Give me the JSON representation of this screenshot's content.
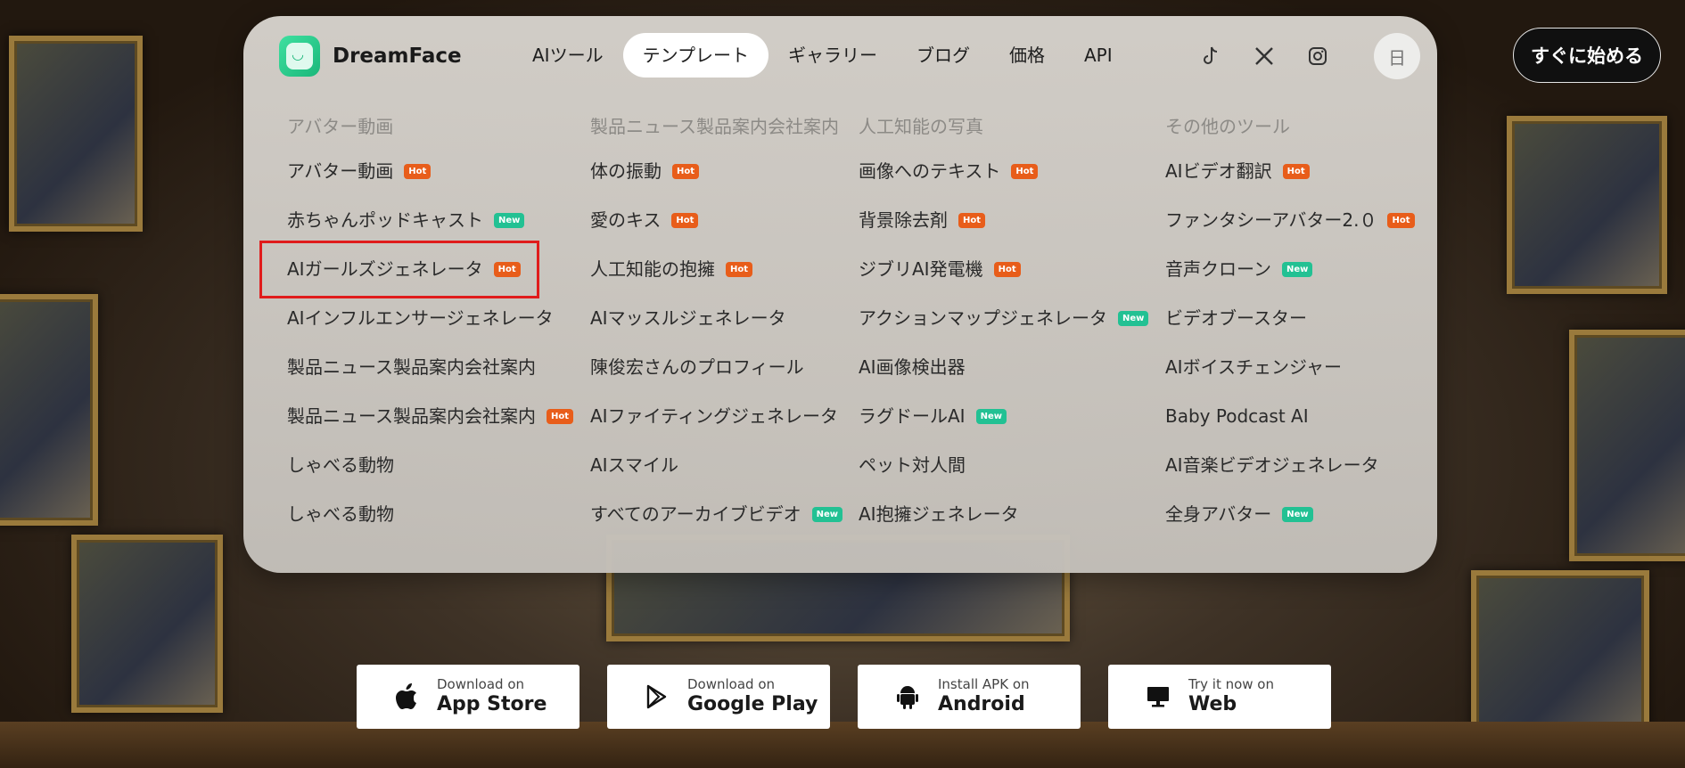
{
  "header": {
    "brand": "DreamFace",
    "nav": [
      {
        "label": "AIツール",
        "active": false
      },
      {
        "label": "テンプレート",
        "active": true
      },
      {
        "label": "ギャラリー",
        "active": false
      },
      {
        "label": "ブログ",
        "active": false
      },
      {
        "label": "価格",
        "active": false
      },
      {
        "label": "API",
        "active": false
      }
    ],
    "social_icons": [
      "tiktok-icon",
      "x-icon",
      "instagram-icon"
    ],
    "language": "日",
    "start_button": "すぐに始める"
  },
  "menu": {
    "columns": [
      {
        "title": "アバター動画",
        "items": [
          {
            "label": "アバター動画",
            "badge": "Hot"
          },
          {
            "label": "赤ちゃんポッドキャスト",
            "badge": "New"
          },
          {
            "label": "AIガールズジェネレータ",
            "badge": "Hot"
          },
          {
            "label": "AIインフルエンサージェネレータ",
            "badge": ""
          },
          {
            "label": "製品ニュース製品案内会社案内",
            "badge": ""
          },
          {
            "label": "製品ニュース製品案内会社案内",
            "badge": "Hot"
          },
          {
            "label": "しゃべる動物",
            "badge": ""
          },
          {
            "label": "しゃべる動物",
            "badge": ""
          }
        ]
      },
      {
        "title": "製品ニュース製品案内会社案内",
        "items": [
          {
            "label": "体の振動",
            "badge": "Hot"
          },
          {
            "label": "愛のキス",
            "badge": "Hot"
          },
          {
            "label": "人工知能の抱擁",
            "badge": "Hot"
          },
          {
            "label": "AIマッスルジェネレータ",
            "badge": ""
          },
          {
            "label": "陳俊宏さんのプロフィール",
            "badge": ""
          },
          {
            "label": "AIファイティングジェネレータ",
            "badge": ""
          },
          {
            "label": "AIスマイル",
            "badge": ""
          },
          {
            "label": "すべてのアーカイブビデオ",
            "badge": "New"
          }
        ]
      },
      {
        "title": "人工知能の写真",
        "items": [
          {
            "label": "画像へのテキスト",
            "badge": "Hot"
          },
          {
            "label": "背景除去剤",
            "badge": "Hot"
          },
          {
            "label": "ジブリAI発電機",
            "badge": "Hot"
          },
          {
            "label": "アクションマップジェネレータ",
            "badge": "New"
          },
          {
            "label": "AI画像検出器",
            "badge": ""
          },
          {
            "label": "ラグドールAI",
            "badge": "New"
          },
          {
            "label": "ペット対人間",
            "badge": ""
          },
          {
            "label": "AI抱擁ジェネレータ",
            "badge": ""
          }
        ]
      },
      {
        "title": "その他のツール",
        "items": [
          {
            "label": "AIビデオ翻訳",
            "badge": "Hot"
          },
          {
            "label": "ファンタシーアバター2.０",
            "badge": "Hot"
          },
          {
            "label": "音声クローン",
            "badge": "New"
          },
          {
            "label": "ビデオブースター",
            "badge": ""
          },
          {
            "label": "AIボイスチェンジャー",
            "badge": ""
          },
          {
            "label": "Baby Podcast AI",
            "badge": ""
          },
          {
            "label": "AI音楽ビデオジェネレータ",
            "badge": ""
          },
          {
            "label": "全身アバター",
            "badge": "New"
          }
        ]
      }
    ]
  },
  "downloads": [
    {
      "small": "Download on",
      "big": "App Store",
      "icon": "apple-icon"
    },
    {
      "small": "Download on",
      "big": "Google Play",
      "icon": "google-play-icon"
    },
    {
      "small": "Install APK on",
      "big": "Android",
      "icon": "android-icon"
    },
    {
      "small": "Try it now on",
      "big": "Web",
      "icon": "monitor-icon"
    }
  ],
  "colors": {
    "hot_badge": "#e85d1a",
    "new_badge": "#22c193",
    "highlight_border": "#e01c1c",
    "brand_green": "#1ab77a"
  }
}
